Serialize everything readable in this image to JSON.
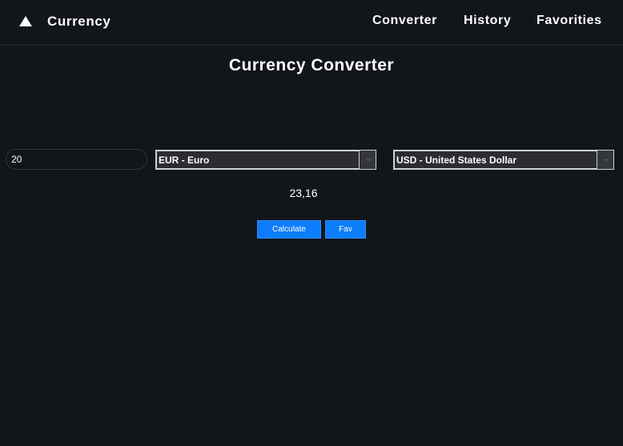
{
  "navbar": {
    "brand_icon": "triangle-up-icon",
    "brand": "Currency",
    "links": [
      "Converter",
      "History",
      "Favorities"
    ]
  },
  "main": {
    "title": "Currency Converter",
    "amount": "20",
    "from_currency": "EUR - Euro",
    "to_currency": "USD - United States Dollar",
    "result": "23,16",
    "calculate_label": "Calculate",
    "fav_label": "Fav"
  },
  "colors": {
    "background": "#12151a",
    "accent": "#0d7dfb",
    "select_bg": "#2b2d31"
  }
}
